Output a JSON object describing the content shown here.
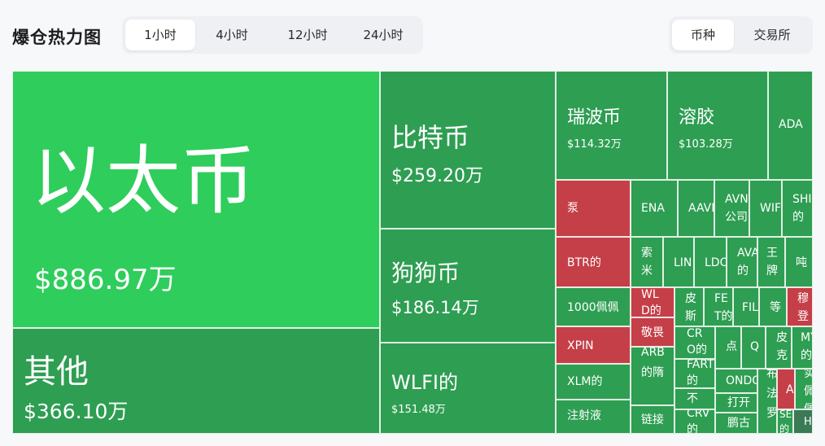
{
  "header": {
    "title": "爆仓热力图",
    "time_tabs": [
      "1小时",
      "4小时",
      "12小时",
      "24小时"
    ],
    "active_time_tab": "1小时",
    "view_tabs": [
      "币种",
      "交易所"
    ],
    "active_view_tab": "币种"
  },
  "colors": {
    "positive_large": "#2fcd5c",
    "positive": "#2e9e52",
    "negative": "#c53f48"
  },
  "heatmap": {
    "tiles": [
      {
        "name": "以太币",
        "value": "$886.97万"
      },
      {
        "name": "其他",
        "value": "$366.10万"
      },
      {
        "name": "比特币",
        "value": "$259.20万"
      },
      {
        "name": "狗狗币",
        "value": "$186.14万"
      },
      {
        "name": "WLFI的",
        "value": "$151.48万"
      },
      {
        "name": "瑞波币",
        "value": "$114.32万"
      },
      {
        "name": "溶胶",
        "value": "$103.28万"
      },
      {
        "name": "ADA"
      },
      {
        "name": "泵"
      },
      {
        "name": "ENA"
      },
      {
        "name": "AAVE"
      },
      {
        "name": "AVN公司"
      },
      {
        "name": "WIF"
      },
      {
        "name": "SHI的"
      },
      {
        "name": "BTR的"
      },
      {
        "name": "索米"
      },
      {
        "name": "LIN"
      },
      {
        "name": "LDO"
      },
      {
        "name": "AVA的"
      },
      {
        "name": "王牌"
      },
      {
        "name": "吨"
      },
      {
        "name": "1000佩佩"
      },
      {
        "name": "WLD的"
      },
      {
        "name": "皮斯"
      },
      {
        "name": "FET的"
      },
      {
        "name": "FIL"
      },
      {
        "name": "等"
      },
      {
        "name": "穆登"
      },
      {
        "name": "XPIN"
      },
      {
        "name": "敬畏"
      },
      {
        "name": "CRO的"
      },
      {
        "name": "点"
      },
      {
        "name": "Q"
      },
      {
        "name": "皮克"
      },
      {
        "name": "MY的"
      },
      {
        "name": "ARB的隋"
      },
      {
        "name": "FART的"
      },
      {
        "name": "XLM的"
      },
      {
        "name": "不"
      },
      {
        "name": "ONDO"
      },
      {
        "name": "布法罗"
      },
      {
        "name": "A"
      },
      {
        "name": "实佩佩"
      },
      {
        "name": "打开"
      },
      {
        "name": "CRV的"
      },
      {
        "name": "注射液"
      },
      {
        "name": "链接"
      },
      {
        "name": "鹏古"
      },
      {
        "name": "SEI的"
      },
      {
        "name": "HBA"
      }
    ]
  }
}
